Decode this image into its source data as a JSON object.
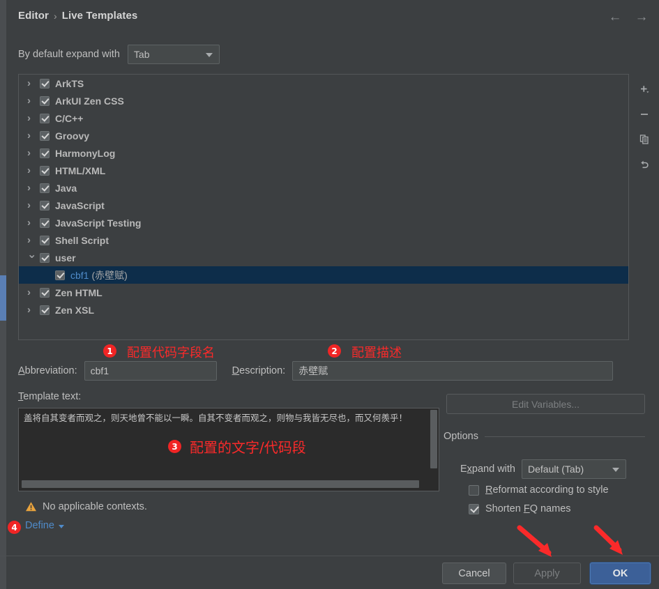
{
  "window": {
    "breadcrumb_root": "Editor",
    "breadcrumb_sep": "›",
    "breadcrumb_current": "Live Templates",
    "nav_back": "←",
    "nav_forward": "→"
  },
  "expand_default": {
    "label": "By default expand with",
    "value": "Tab"
  },
  "tree": {
    "items": [
      {
        "label": "ArkTS",
        "checked": true,
        "expandable": true,
        "expanded": false,
        "child": false,
        "selected": false
      },
      {
        "label": "ArkUI Zen CSS",
        "checked": true,
        "expandable": true,
        "expanded": false,
        "child": false,
        "selected": false
      },
      {
        "label": "C/C++",
        "checked": true,
        "expandable": true,
        "expanded": false,
        "child": false,
        "selected": false
      },
      {
        "label": "Groovy",
        "checked": true,
        "expandable": true,
        "expanded": false,
        "child": false,
        "selected": false
      },
      {
        "label": "HarmonyLog",
        "checked": true,
        "expandable": true,
        "expanded": false,
        "child": false,
        "selected": false
      },
      {
        "label": "HTML/XML",
        "checked": true,
        "expandable": true,
        "expanded": false,
        "child": false,
        "selected": false
      },
      {
        "label": "Java",
        "checked": true,
        "expandable": true,
        "expanded": false,
        "child": false,
        "selected": false
      },
      {
        "label": "JavaScript",
        "checked": true,
        "expandable": true,
        "expanded": false,
        "child": false,
        "selected": false
      },
      {
        "label": "JavaScript Testing",
        "checked": true,
        "expandable": true,
        "expanded": false,
        "child": false,
        "selected": false
      },
      {
        "label": "Shell Script",
        "checked": true,
        "expandable": true,
        "expanded": false,
        "child": false,
        "selected": false
      },
      {
        "label": "user",
        "checked": true,
        "expandable": true,
        "expanded": true,
        "child": false,
        "selected": false
      },
      {
        "label": "cbf1",
        "sub": "(赤壁赋)",
        "checked": true,
        "expandable": false,
        "expanded": false,
        "child": true,
        "selected": true
      },
      {
        "label": "Zen HTML",
        "checked": true,
        "expandable": true,
        "expanded": false,
        "child": false,
        "selected": false
      },
      {
        "label": "Zen XSL",
        "checked": true,
        "expandable": true,
        "expanded": false,
        "child": false,
        "selected": false
      }
    ],
    "toolbar": {
      "add": "add-icon",
      "remove": "remove-icon",
      "duplicate": "duplicate-icon",
      "revert": "revert-icon"
    }
  },
  "fields": {
    "abbreviation_label": "Abbreviation:",
    "abbreviation_value": "cbf1",
    "description_label": "Description:",
    "description_value": "赤壁赋"
  },
  "template_text": {
    "label": "Template text:",
    "value": "盖将自其变者而观之，则天地曾不能以一瞬。自其不变者而观之，则物与我皆无尽也，而又何羨乎！"
  },
  "options": {
    "edit_variables_label": "Edit Variables...",
    "section_title": "Options",
    "expand_with_label": "Expand with",
    "expand_with_value": "Default (Tab)",
    "reformat_label": "Reformat according to style",
    "reformat_checked": false,
    "shorten_label": "Shorten FQ names",
    "shorten_checked": true
  },
  "contexts": {
    "warning_text": "No applicable contexts.",
    "define_label": "Define"
  },
  "footer": {
    "cancel": "Cancel",
    "apply": "Apply",
    "ok": "OK"
  },
  "annotations": {
    "one_num": "1",
    "one_text": "配置代码字段名",
    "two_num": "2",
    "two_text": "配置描述",
    "three_num": "3",
    "three_text": "配置的文字/代码段",
    "four_num": "4"
  },
  "colors": {
    "accent_blue": "#4f8bc9",
    "ok_button": "#3c6098",
    "selection": "#0d2d4a",
    "annotation_red": "#fa2a2a",
    "warning_amber": "#e8a33d",
    "background": "#3c3f41"
  }
}
